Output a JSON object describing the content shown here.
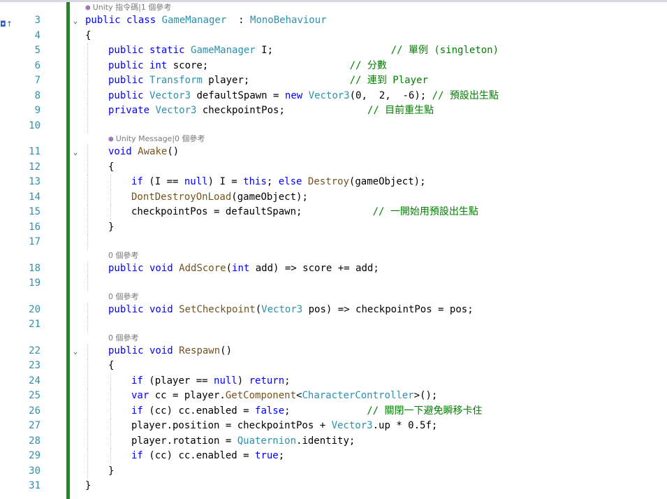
{
  "editor": {
    "lines": [
      {
        "kind": "lens",
        "text": "Unity 指令碼|1 個參考",
        "indent": 0,
        "glyph": true
      },
      {
        "kind": "code",
        "num": "3",
        "fold": true,
        "indent": 0,
        "tokens": [
          [
            "kw",
            "public class "
          ],
          [
            "ty",
            "GameManager"
          ],
          [
            "",
            "  : "
          ],
          [
            "ty",
            "MonoBehaviour"
          ]
        ]
      },
      {
        "kind": "code",
        "num": "4",
        "indent": 0,
        "guides": [],
        "tokens": [
          [
            "",
            "{"
          ]
        ]
      },
      {
        "kind": "code",
        "num": "5",
        "indent": 1,
        "guides": [
          1
        ],
        "tokens": [
          [
            "kw",
            "public static "
          ],
          [
            "ty",
            "GameManager"
          ],
          [
            "",
            " I;                    "
          ],
          [
            "cm",
            "// 單例 (singleton)"
          ]
        ]
      },
      {
        "kind": "code",
        "num": "6",
        "indent": 1,
        "guides": [
          1
        ],
        "tokens": [
          [
            "kw",
            "public int "
          ],
          [
            "",
            "score;                        "
          ],
          [
            "cm",
            "// 分數"
          ]
        ]
      },
      {
        "kind": "code",
        "num": "7",
        "indent": 1,
        "guides": [
          1
        ],
        "tokens": [
          [
            "kw",
            "public "
          ],
          [
            "ty",
            "Transform"
          ],
          [
            "",
            " player;                 "
          ],
          [
            "cm",
            "// 連到 Player"
          ]
        ]
      },
      {
        "kind": "code",
        "num": "8",
        "indent": 1,
        "guides": [
          1
        ],
        "tokens": [
          [
            "kw",
            "public "
          ],
          [
            "ty",
            "Vector3"
          ],
          [
            "",
            " defaultSpawn = "
          ],
          [
            "kw",
            "new "
          ],
          [
            "ty",
            "Vector3"
          ],
          [
            "",
            "(0,  2,  -6); "
          ],
          [
            "cm",
            "// 預設出生點"
          ]
        ]
      },
      {
        "kind": "code",
        "num": "9",
        "indent": 1,
        "guides": [
          1
        ],
        "tokens": [
          [
            "kw",
            "private "
          ],
          [
            "ty",
            "Vector3"
          ],
          [
            "",
            " checkpointPos;              "
          ],
          [
            "cm",
            "// 目前重生點"
          ]
        ]
      },
      {
        "kind": "code",
        "num": "10",
        "indent": 1,
        "guides": [
          1
        ],
        "tokens": []
      },
      {
        "kind": "lens",
        "text": "Unity Message|0 個參考",
        "indent": 1,
        "glyph": true
      },
      {
        "kind": "code",
        "num": "11",
        "fold": true,
        "indent": 1,
        "guides": [
          1
        ],
        "tokens": [
          [
            "kw",
            "void "
          ],
          [
            "mt",
            "Awake"
          ],
          [
            "",
            "()"
          ]
        ]
      },
      {
        "kind": "code",
        "num": "12",
        "indent": 1,
        "guides": [
          1
        ],
        "tokens": [
          [
            "",
            "{"
          ]
        ]
      },
      {
        "kind": "code",
        "num": "13",
        "indent": 2,
        "guides": [
          1,
          2
        ],
        "tokens": [
          [
            "kw",
            "if "
          ],
          [
            "",
            "(I == "
          ],
          [
            "kw",
            "null"
          ],
          [
            "",
            ") I = "
          ],
          [
            "kw",
            "this"
          ],
          [
            "",
            "; "
          ],
          [
            "kw",
            "else "
          ],
          [
            "mt",
            "Destroy"
          ],
          [
            "",
            "(gameObject);"
          ]
        ]
      },
      {
        "kind": "code",
        "num": "14",
        "indent": 2,
        "guides": [
          1,
          2
        ],
        "tokens": [
          [
            "mt",
            "DontDestroyOnLoad"
          ],
          [
            "",
            "(gameObject);"
          ]
        ]
      },
      {
        "kind": "code",
        "num": "15",
        "indent": 2,
        "guides": [
          1,
          2
        ],
        "tokens": [
          [
            "",
            "checkpointPos = defaultSpawn;            "
          ],
          [
            "cm",
            "// 一開始用預設出生點"
          ]
        ]
      },
      {
        "kind": "code",
        "num": "16",
        "indent": 1,
        "guides": [
          1
        ],
        "tokens": [
          [
            "",
            "}"
          ]
        ]
      },
      {
        "kind": "code",
        "num": "17",
        "indent": 1,
        "guides": [
          1
        ],
        "tokens": []
      },
      {
        "kind": "lens",
        "text": "0 個參考",
        "indent": 1,
        "glyph": false
      },
      {
        "kind": "code",
        "num": "18",
        "indent": 1,
        "guides": [
          1
        ],
        "tokens": [
          [
            "kw",
            "public void "
          ],
          [
            "mt",
            "AddScore"
          ],
          [
            "",
            "("
          ],
          [
            "kw",
            "int "
          ],
          [
            "",
            "add) => score += add;"
          ]
        ]
      },
      {
        "kind": "code",
        "num": "19",
        "indent": 1,
        "guides": [
          1
        ],
        "tokens": []
      },
      {
        "kind": "lens",
        "text": "0 個參考",
        "indent": 1,
        "glyph": false
      },
      {
        "kind": "code",
        "num": "20",
        "indent": 1,
        "guides": [
          1
        ],
        "tokens": [
          [
            "kw",
            "public void "
          ],
          [
            "mt",
            "SetCheckpoint"
          ],
          [
            "",
            "("
          ],
          [
            "ty",
            "Vector3"
          ],
          [
            "",
            " pos) => checkpointPos = pos;"
          ]
        ]
      },
      {
        "kind": "code",
        "num": "21",
        "indent": 1,
        "guides": [
          1
        ],
        "tokens": []
      },
      {
        "kind": "lens",
        "text": "0 個參考",
        "indent": 1,
        "glyph": false
      },
      {
        "kind": "code",
        "num": "22",
        "fold": true,
        "indent": 1,
        "guides": [
          1
        ],
        "tokens": [
          [
            "kw",
            "public void "
          ],
          [
            "mt",
            "Respawn"
          ],
          [
            "",
            "()"
          ]
        ]
      },
      {
        "kind": "code",
        "num": "23",
        "indent": 1,
        "guides": [
          1
        ],
        "tokens": [
          [
            "",
            "{"
          ]
        ]
      },
      {
        "kind": "code",
        "num": "24",
        "indent": 2,
        "guides": [
          1,
          2
        ],
        "tokens": [
          [
            "kw",
            "if "
          ],
          [
            "",
            "(player == "
          ],
          [
            "kw",
            "null"
          ],
          [
            "",
            ") "
          ],
          [
            "kw",
            "return"
          ],
          [
            "",
            ";"
          ]
        ]
      },
      {
        "kind": "code",
        "num": "25",
        "indent": 2,
        "guides": [
          1,
          2
        ],
        "tokens": [
          [
            "kw",
            "var "
          ],
          [
            "",
            "cc = player."
          ],
          [
            "mt",
            "GetComponent"
          ],
          [
            "",
            "<"
          ],
          [
            "ty",
            "CharacterController"
          ],
          [
            "",
            ">();"
          ]
        ]
      },
      {
        "kind": "code",
        "num": "26",
        "indent": 2,
        "guides": [
          1,
          2
        ],
        "tokens": [
          [
            "kw",
            "if "
          ],
          [
            "",
            "(cc) cc.enabled = "
          ],
          [
            "kw",
            "false"
          ],
          [
            "",
            ";             "
          ],
          [
            "cm",
            "// 關閉一下避免瞬移卡住"
          ]
        ]
      },
      {
        "kind": "code",
        "num": "27",
        "indent": 2,
        "guides": [
          1,
          2
        ],
        "tokens": [
          [
            "",
            "player.position = checkpointPos + "
          ],
          [
            "ty",
            "Vector3"
          ],
          [
            "",
            ".up * 0.5f;"
          ]
        ]
      },
      {
        "kind": "code",
        "num": "28",
        "indent": 2,
        "guides": [
          1,
          2
        ],
        "tokens": [
          [
            "",
            "player.rotation = "
          ],
          [
            "ty",
            "Quaternion"
          ],
          [
            "",
            ".identity;"
          ]
        ]
      },
      {
        "kind": "code",
        "num": "29",
        "indent": 2,
        "guides": [
          1,
          2
        ],
        "tokens": [
          [
            "kw",
            "if "
          ],
          [
            "",
            "(cc) cc.enabled = "
          ],
          [
            "kw",
            "true"
          ],
          [
            "",
            ";"
          ]
        ]
      },
      {
        "kind": "code",
        "num": "30",
        "indent": 1,
        "guides": [
          1
        ],
        "tokens": [
          [
            "",
            "}"
          ]
        ]
      },
      {
        "kind": "code",
        "num": "31",
        "indent": 0,
        "guides": [],
        "tokens": [
          [
            "",
            "}"
          ]
        ]
      }
    ],
    "colors": {
      "keyword": "#0000ff",
      "type": "#2b91af",
      "method": "#74531f",
      "comment": "#008000",
      "line_number": "#2b91af",
      "change_bar": "#1f8a1f"
    }
  }
}
